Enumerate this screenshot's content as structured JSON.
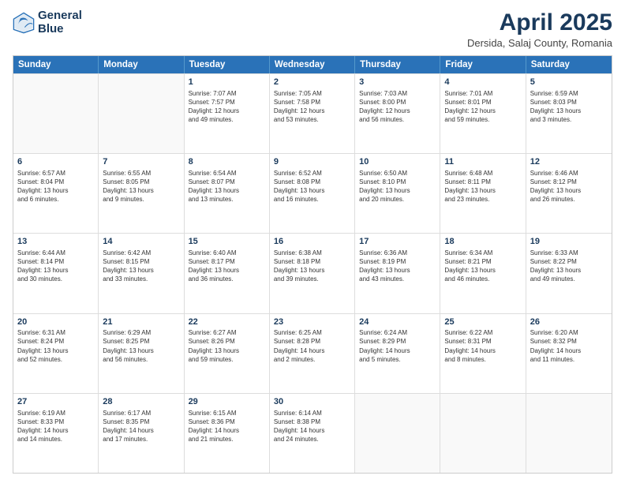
{
  "header": {
    "logo_line1": "General",
    "logo_line2": "Blue",
    "month_title": "April 2025",
    "location": "Dersida, Salaj County, Romania"
  },
  "calendar": {
    "days_of_week": [
      "Sunday",
      "Monday",
      "Tuesday",
      "Wednesday",
      "Thursday",
      "Friday",
      "Saturday"
    ],
    "rows": [
      [
        {
          "day": "",
          "text": ""
        },
        {
          "day": "",
          "text": ""
        },
        {
          "day": "1",
          "text": "Sunrise: 7:07 AM\nSunset: 7:57 PM\nDaylight: 12 hours\nand 49 minutes."
        },
        {
          "day": "2",
          "text": "Sunrise: 7:05 AM\nSunset: 7:58 PM\nDaylight: 12 hours\nand 53 minutes."
        },
        {
          "day": "3",
          "text": "Sunrise: 7:03 AM\nSunset: 8:00 PM\nDaylight: 12 hours\nand 56 minutes."
        },
        {
          "day": "4",
          "text": "Sunrise: 7:01 AM\nSunset: 8:01 PM\nDaylight: 12 hours\nand 59 minutes."
        },
        {
          "day": "5",
          "text": "Sunrise: 6:59 AM\nSunset: 8:03 PM\nDaylight: 13 hours\nand 3 minutes."
        }
      ],
      [
        {
          "day": "6",
          "text": "Sunrise: 6:57 AM\nSunset: 8:04 PM\nDaylight: 13 hours\nand 6 minutes."
        },
        {
          "day": "7",
          "text": "Sunrise: 6:55 AM\nSunset: 8:05 PM\nDaylight: 13 hours\nand 9 minutes."
        },
        {
          "day": "8",
          "text": "Sunrise: 6:54 AM\nSunset: 8:07 PM\nDaylight: 13 hours\nand 13 minutes."
        },
        {
          "day": "9",
          "text": "Sunrise: 6:52 AM\nSunset: 8:08 PM\nDaylight: 13 hours\nand 16 minutes."
        },
        {
          "day": "10",
          "text": "Sunrise: 6:50 AM\nSunset: 8:10 PM\nDaylight: 13 hours\nand 20 minutes."
        },
        {
          "day": "11",
          "text": "Sunrise: 6:48 AM\nSunset: 8:11 PM\nDaylight: 13 hours\nand 23 minutes."
        },
        {
          "day": "12",
          "text": "Sunrise: 6:46 AM\nSunset: 8:12 PM\nDaylight: 13 hours\nand 26 minutes."
        }
      ],
      [
        {
          "day": "13",
          "text": "Sunrise: 6:44 AM\nSunset: 8:14 PM\nDaylight: 13 hours\nand 30 minutes."
        },
        {
          "day": "14",
          "text": "Sunrise: 6:42 AM\nSunset: 8:15 PM\nDaylight: 13 hours\nand 33 minutes."
        },
        {
          "day": "15",
          "text": "Sunrise: 6:40 AM\nSunset: 8:17 PM\nDaylight: 13 hours\nand 36 minutes."
        },
        {
          "day": "16",
          "text": "Sunrise: 6:38 AM\nSunset: 8:18 PM\nDaylight: 13 hours\nand 39 minutes."
        },
        {
          "day": "17",
          "text": "Sunrise: 6:36 AM\nSunset: 8:19 PM\nDaylight: 13 hours\nand 43 minutes."
        },
        {
          "day": "18",
          "text": "Sunrise: 6:34 AM\nSunset: 8:21 PM\nDaylight: 13 hours\nand 46 minutes."
        },
        {
          "day": "19",
          "text": "Sunrise: 6:33 AM\nSunset: 8:22 PM\nDaylight: 13 hours\nand 49 minutes."
        }
      ],
      [
        {
          "day": "20",
          "text": "Sunrise: 6:31 AM\nSunset: 8:24 PM\nDaylight: 13 hours\nand 52 minutes."
        },
        {
          "day": "21",
          "text": "Sunrise: 6:29 AM\nSunset: 8:25 PM\nDaylight: 13 hours\nand 56 minutes."
        },
        {
          "day": "22",
          "text": "Sunrise: 6:27 AM\nSunset: 8:26 PM\nDaylight: 13 hours\nand 59 minutes."
        },
        {
          "day": "23",
          "text": "Sunrise: 6:25 AM\nSunset: 8:28 PM\nDaylight: 14 hours\nand 2 minutes."
        },
        {
          "day": "24",
          "text": "Sunrise: 6:24 AM\nSunset: 8:29 PM\nDaylight: 14 hours\nand 5 minutes."
        },
        {
          "day": "25",
          "text": "Sunrise: 6:22 AM\nSunset: 8:31 PM\nDaylight: 14 hours\nand 8 minutes."
        },
        {
          "day": "26",
          "text": "Sunrise: 6:20 AM\nSunset: 8:32 PM\nDaylight: 14 hours\nand 11 minutes."
        }
      ],
      [
        {
          "day": "27",
          "text": "Sunrise: 6:19 AM\nSunset: 8:33 PM\nDaylight: 14 hours\nand 14 minutes."
        },
        {
          "day": "28",
          "text": "Sunrise: 6:17 AM\nSunset: 8:35 PM\nDaylight: 14 hours\nand 17 minutes."
        },
        {
          "day": "29",
          "text": "Sunrise: 6:15 AM\nSunset: 8:36 PM\nDaylight: 14 hours\nand 21 minutes."
        },
        {
          "day": "30",
          "text": "Sunrise: 6:14 AM\nSunset: 8:38 PM\nDaylight: 14 hours\nand 24 minutes."
        },
        {
          "day": "",
          "text": ""
        },
        {
          "day": "",
          "text": ""
        },
        {
          "day": "",
          "text": ""
        }
      ]
    ]
  }
}
